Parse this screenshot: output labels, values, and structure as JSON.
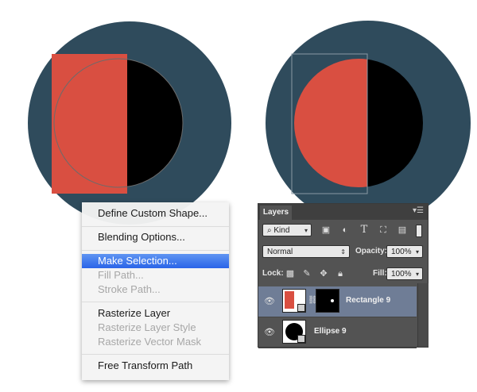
{
  "colors": {
    "circle_fill": "#2f4b5c",
    "rect_red": "#d94f41",
    "semicircle_black": "#000000",
    "selection_blue": "#2a64e8"
  },
  "context_menu": {
    "items": [
      {
        "label": "Define Custom Shape...",
        "state": "enabled"
      },
      {
        "label": "Blending Options...",
        "state": "enabled"
      },
      {
        "label": "Make Selection...",
        "state": "selected"
      },
      {
        "label": "Fill Path...",
        "state": "disabled"
      },
      {
        "label": "Stroke Path...",
        "state": "disabled"
      },
      {
        "label": "Rasterize Layer",
        "state": "enabled"
      },
      {
        "label": "Rasterize Layer Style",
        "state": "disabled"
      },
      {
        "label": "Rasterize Vector Mask",
        "state": "disabled"
      },
      {
        "label": "Free Transform Path",
        "state": "enabled"
      }
    ]
  },
  "layers_panel": {
    "tab": "Layers",
    "filter_kind": "Kind",
    "blend_mode": "Normal",
    "opacity_label": "Opacity:",
    "opacity_value": "100%",
    "lock_label": "Lock:",
    "fill_label": "Fill:",
    "fill_value": "100%",
    "filter_icons": [
      "image-filter-icon",
      "adjustment-filter-icon",
      "type-filter-icon",
      "shape-filter-icon",
      "smart-object-filter-icon"
    ],
    "lock_icons": [
      "lock-transparent-icon",
      "lock-image-icon",
      "lock-position-icon",
      "lock-all-icon"
    ],
    "layers": [
      {
        "name": "Rectangle 9",
        "active": true
      },
      {
        "name": "Ellipse 9",
        "active": false
      }
    ]
  }
}
